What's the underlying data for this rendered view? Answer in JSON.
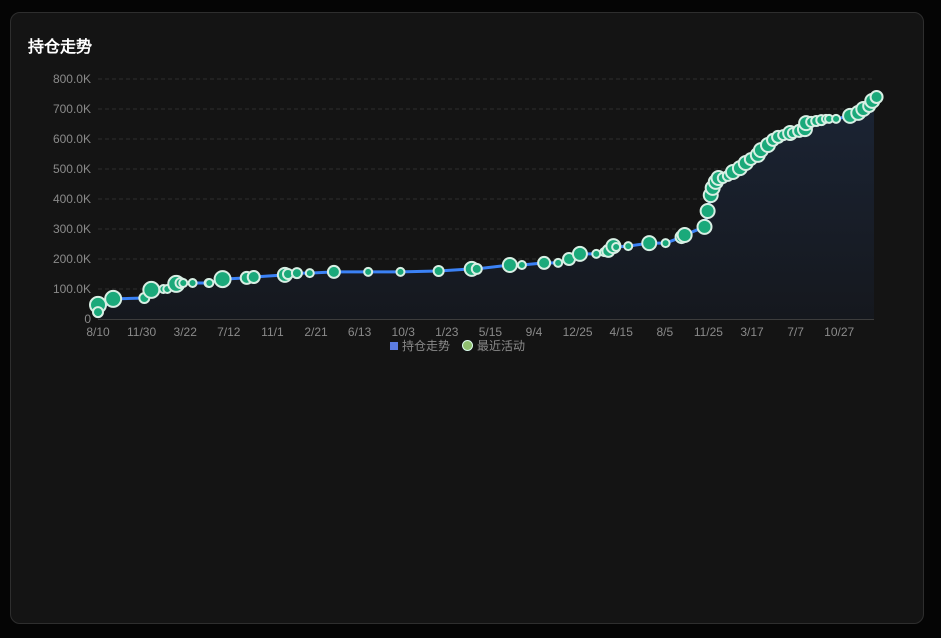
{
  "card": {
    "title": "持仓走势"
  },
  "chart_data": {
    "type": "line",
    "title": "持仓走势",
    "ylim": [
      0,
      800
    ],
    "y_unit": "K",
    "y_ticks": [
      "0",
      "100.0K",
      "200.0K",
      "300.0K",
      "400.0K",
      "500.0K",
      "600.0K",
      "700.0K",
      "800.0K"
    ],
    "x_ticks": [
      "8/10",
      "11/30",
      "3/22",
      "7/12",
      "11/1",
      "2/21",
      "6/13",
      "10/3",
      "1/23",
      "5/15",
      "9/4",
      "12/25",
      "4/15",
      "8/5",
      "11/25",
      "3/17",
      "7/7",
      "10/27"
    ],
    "x_tick_days": 112,
    "xlim_days": [
      0,
      2005
    ],
    "grid": true,
    "legend": {
      "position": "bottom",
      "items": [
        "持仓走势",
        "最近活动"
      ]
    },
    "series": [
      {
        "name": "持仓走势",
        "color": "#3b82f6"
      },
      {
        "name": "最近活动",
        "color": "#1aa97a",
        "points": [
          [
            0,
            47,
            8
          ],
          [
            0,
            23,
            5
          ],
          [
            39,
            67,
            8
          ],
          [
            119,
            70,
            5
          ],
          [
            137,
            97,
            8
          ],
          [
            168,
            100,
            4
          ],
          [
            178,
            100,
            4
          ],
          [
            201,
            117,
            8
          ],
          [
            212,
            120,
            5
          ],
          [
            219,
            120,
            4
          ],
          [
            243,
            120,
            4
          ],
          [
            284,
            120,
            4
          ],
          [
            286,
            120,
            4
          ],
          [
            320,
            133,
            8
          ],
          [
            382,
            137,
            6
          ],
          [
            400,
            140,
            6
          ],
          [
            480,
            147,
            7
          ],
          [
            488,
            150,
            5
          ],
          [
            511,
            153,
            5
          ],
          [
            544,
            153,
            4
          ],
          [
            606,
            157,
            6
          ],
          [
            694,
            157,
            4
          ],
          [
            777,
            157,
            4
          ],
          [
            875,
            160,
            5
          ],
          [
            960,
            167,
            7
          ],
          [
            973,
            167,
            5
          ],
          [
            1058,
            180,
            7
          ],
          [
            1089,
            180,
            4
          ],
          [
            1146,
            187,
            6
          ],
          [
            1182,
            187,
            4
          ],
          [
            1210,
            200,
            6
          ],
          [
            1238,
            217,
            7
          ],
          [
            1280,
            217,
            4
          ],
          [
            1300,
            223,
            4
          ],
          [
            1311,
            227,
            6
          ],
          [
            1324,
            243,
            7
          ],
          [
            1331,
            240,
            4
          ],
          [
            1362,
            243,
            4
          ],
          [
            1416,
            253,
            7
          ],
          [
            1458,
            253,
            4
          ],
          [
            1499,
            273,
            6
          ],
          [
            1507,
            280,
            7
          ],
          [
            1558,
            307,
            7
          ],
          [
            1566,
            360,
            7
          ],
          [
            1574,
            413,
            7
          ],
          [
            1579,
            437,
            7
          ],
          [
            1587,
            457,
            7
          ],
          [
            1594,
            470,
            7
          ],
          [
            1605,
            470,
            5
          ],
          [
            1618,
            477,
            5
          ],
          [
            1631,
            490,
            7
          ],
          [
            1649,
            503,
            7
          ],
          [
            1664,
            520,
            7
          ],
          [
            1677,
            533,
            6
          ],
          [
            1695,
            547,
            7
          ],
          [
            1703,
            563,
            7
          ],
          [
            1721,
            580,
            7
          ],
          [
            1734,
            597,
            6
          ],
          [
            1747,
            607,
            6
          ],
          [
            1760,
            613,
            5
          ],
          [
            1778,
            620,
            7
          ],
          [
            1785,
            620,
            5
          ],
          [
            1801,
            627,
            6
          ],
          [
            1816,
            633,
            7
          ],
          [
            1819,
            653,
            7
          ],
          [
            1832,
            657,
            5
          ],
          [
            1845,
            660,
            5
          ],
          [
            1858,
            663,
            5
          ],
          [
            1870,
            667,
            4
          ],
          [
            1878,
            667,
            4
          ],
          [
            1896,
            667,
            4
          ],
          [
            1932,
            677,
            7
          ],
          [
            1953,
            687,
            7
          ],
          [
            1966,
            700,
            7
          ],
          [
            1981,
            710,
            6
          ],
          [
            1989,
            727,
            7
          ],
          [
            2000,
            740,
            6
          ]
        ]
      }
    ]
  }
}
